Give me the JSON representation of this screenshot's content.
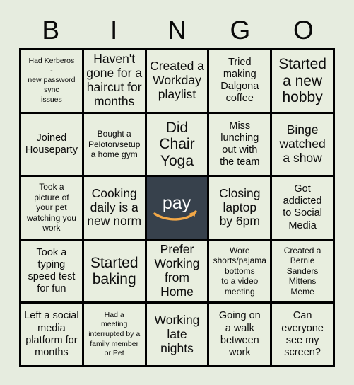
{
  "header": {
    "letters": [
      "B",
      "I",
      "N",
      "G",
      "O"
    ]
  },
  "colors": {
    "page_background": "#e6ecdf",
    "cell_background": "#e8eedf",
    "grid_line": "#000000",
    "text": "#0d0d0d",
    "free_space_background": "#37414c",
    "free_space_word": "#ffffff",
    "free_space_arrow": "#f3a847"
  },
  "grid": {
    "rows": 5,
    "columns": 5,
    "cells": [
      {
        "text": "Had Kerberos\n-\nnew password\nsync\nissues",
        "size": "fs-xs",
        "marked": false
      },
      {
        "text": "Haven't\ngone for a\nhaircut for\nmonths",
        "size": "fs-lg",
        "marked": false
      },
      {
        "text": "Created a\nWorkday\nplaylist",
        "size": "fs-lg",
        "marked": false
      },
      {
        "text": "Tried\nmaking\nDalgona\ncoffee",
        "size": "fs-md",
        "marked": false
      },
      {
        "text": "Started\na new\nhobby",
        "size": "fs-xl",
        "marked": false
      },
      {
        "text": "Joined\nHouseparty",
        "size": "fs-md",
        "marked": false
      },
      {
        "text": "Bought a\nPeloton/setup\na home gym",
        "size": "fs-sm",
        "marked": false
      },
      {
        "text": "Did\nChair\nYoga",
        "size": "fs-xl",
        "marked": false
      },
      {
        "text": "Miss\nlunching\nout with\nthe team",
        "size": "fs-md",
        "marked": false
      },
      {
        "text": "Binge\nwatched\na show",
        "size": "fs-lg",
        "marked": false
      },
      {
        "text": "Took a\npicture of\nyour pet\nwatching you\nwork",
        "size": "fs-sm",
        "marked": false
      },
      {
        "text": "Cooking\ndaily is a\nnew norm",
        "size": "fs-lg",
        "marked": false
      },
      {
        "text": "pay",
        "size": "fs-lg",
        "marked": true,
        "free_space": true,
        "icon": "amazon-pay-logo"
      },
      {
        "text": "Closing\nlaptop\nby 6pm",
        "size": "fs-lg",
        "marked": false
      },
      {
        "text": "Got\naddicted\nto Social\nMedia",
        "size": "fs-md",
        "marked": false
      },
      {
        "text": "Took a\ntyping\nspeed test\nfor fun",
        "size": "fs-md",
        "marked": false
      },
      {
        "text": "Started\nbaking",
        "size": "fs-xl",
        "marked": false
      },
      {
        "text": "Prefer\nWorking\nfrom\nHome",
        "size": "fs-lg",
        "marked": false
      },
      {
        "text": "Wore\nshorts/pajama\nbottoms\nto a video\nmeeting",
        "size": "fs-sm",
        "marked": false
      },
      {
        "text": "Created a\nBernie\nSanders\nMittens\nMeme",
        "size": "fs-sm",
        "marked": false
      },
      {
        "text": "Left a social\nmedia\nplatform for\nmonths",
        "size": "fs-md",
        "marked": false
      },
      {
        "text": "Had a\nmeeting\ninterrupted by a\nfamily member\nor Pet",
        "size": "fs-xs",
        "marked": false
      },
      {
        "text": "Working\nlate\nnights",
        "size": "fs-lg",
        "marked": false
      },
      {
        "text": "Going on\na walk\nbetween\nwork",
        "size": "fs-md",
        "marked": false
      },
      {
        "text": "Can\neveryone\nsee my\nscreen?",
        "size": "fs-md",
        "marked": false
      }
    ]
  }
}
